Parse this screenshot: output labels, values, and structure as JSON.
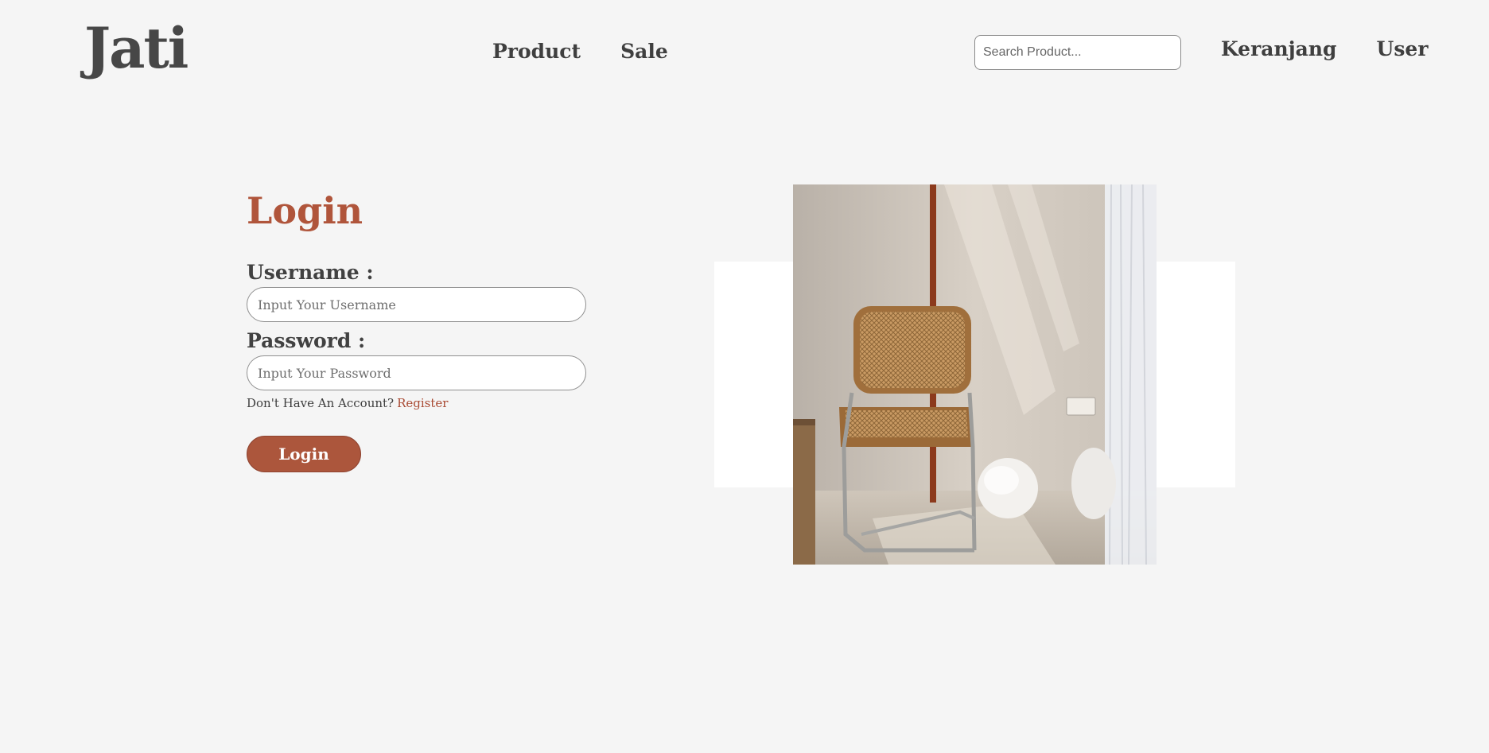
{
  "header": {
    "logo": "Jati",
    "nav": {
      "product": "Product",
      "sale": "Sale"
    },
    "search": {
      "placeholder": "Search Product...",
      "value": ""
    },
    "right": {
      "cart": "Keranjang",
      "user": "User"
    }
  },
  "login": {
    "title": "Login",
    "username": {
      "label": "Username :",
      "placeholder": "Input Your Username",
      "value": ""
    },
    "password": {
      "label": "Password :",
      "placeholder": "Input Your Password",
      "value": ""
    },
    "account_prompt": "Don't Have An Account?",
    "register_link": "Register",
    "submit_label": "Login"
  },
  "colors": {
    "accent": "#ac563c",
    "background": "#f5f5f5",
    "text": "#454545"
  }
}
